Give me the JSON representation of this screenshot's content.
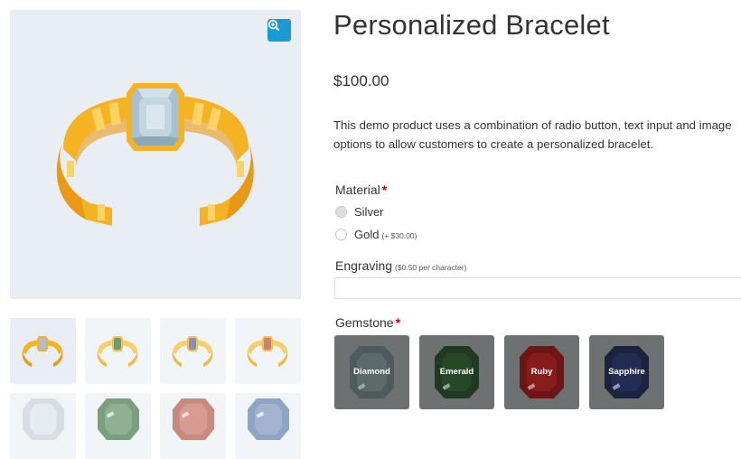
{
  "product": {
    "title": "Personalized Bracelet",
    "price": "$100.00",
    "description": "This demo product uses a combination of radio button, text input and image options to allow customers to create a personalized bracelet."
  },
  "gallery": {
    "zoom_icon": "zoom-in-icon",
    "thumbnails": [
      {
        "name": "bracelet-blue-gem",
        "gem": "#a9bfcf"
      },
      {
        "name": "bracelet-green-gem",
        "gem": "#6f9a7a"
      },
      {
        "name": "bracelet-purple-gem",
        "gem": "#8a8fb5"
      },
      {
        "name": "bracelet-red-gem",
        "gem": "#c98374"
      },
      {
        "name": "gem-white",
        "gem": "#d7dde2"
      },
      {
        "name": "gem-green",
        "gem": "#7c9e7e"
      },
      {
        "name": "gem-red",
        "gem": "#c98a7e"
      },
      {
        "name": "gem-blue",
        "gem": "#8fa3c2"
      }
    ]
  },
  "options": {
    "material": {
      "label": "Material",
      "required": "*",
      "choices": [
        {
          "label": "Silver",
          "note": "",
          "selected": true
        },
        {
          "label": "Gold",
          "note": "(+ $30.00)",
          "selected": false
        }
      ]
    },
    "engraving": {
      "label": "Engraving",
      "note": "($0.50 per character)",
      "value": ""
    },
    "gemstone": {
      "label": "Gemstone",
      "required": "*",
      "choices": [
        {
          "label": "Diamond",
          "color": "#4e5a5b"
        },
        {
          "label": "Emerald",
          "color": "#1f3a20"
        },
        {
          "label": "Ruby",
          "color": "#6e1616"
        },
        {
          "label": "Sapphire",
          "color": "#1c2340"
        }
      ]
    }
  },
  "colors": {
    "accent": "#1a9ad6",
    "gold": "#f5b324",
    "gold_dark": "#e89a17",
    "gem_blue": "#a9c1cf",
    "required": "#cc0000"
  }
}
